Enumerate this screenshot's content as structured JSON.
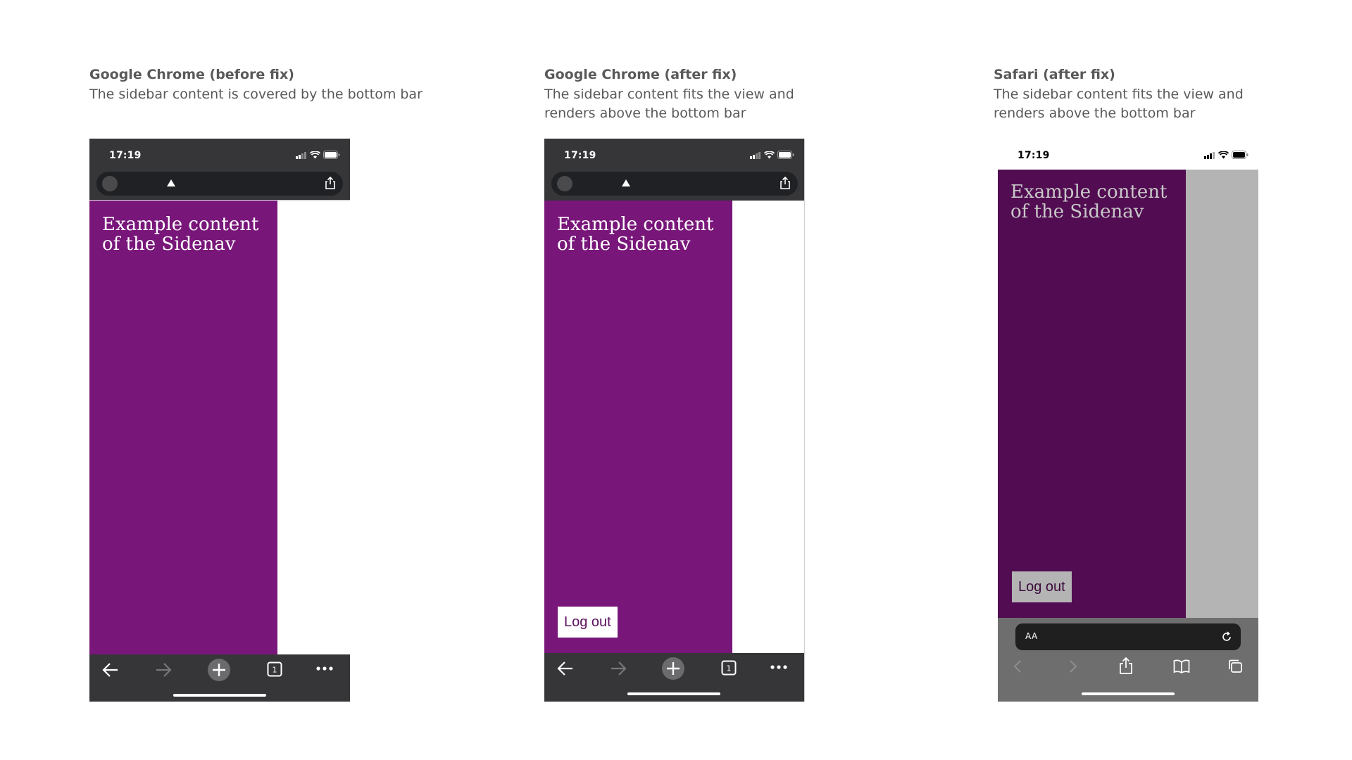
{
  "panels": [
    {
      "title": "Google Chrome (before fix)",
      "description": "The sidebar content is covered by the bottom bar",
      "status_time": "17:19",
      "sidenav_text": "Example content of the Sidenav",
      "logout_label": "",
      "tab_count": "1"
    },
    {
      "title": "Google Chrome (after fix)",
      "description": "The sidebar content fits the view and renders above the bottom bar",
      "status_time": "17:19",
      "sidenav_text": "Example content of the Sidenav",
      "logout_label": "Log out",
      "tab_count": "1"
    },
    {
      "title": "Safari (after fix)",
      "description": "The sidebar content fits the view and renders above the bottom bar",
      "status_time": "17:19",
      "sidenav_text": "Example content of the Sidenav",
      "logout_label": "Log out",
      "address_text_size_label": "AA"
    }
  ],
  "colors": {
    "chrome_bar": "#363638",
    "sidenav_purple": "#78167a",
    "safari_sidenav": "#520d52",
    "safari_overlay": "#b4b4b4",
    "safari_bar": "#6e6e6e",
    "caption_text": "#595959"
  },
  "icons": {
    "incognito": "incognito-icon",
    "share": "share-icon",
    "back": "back-arrow-icon",
    "forward": "forward-arrow-icon",
    "new_tab": "plus-icon",
    "tabs": "tab-switcher-icon",
    "menu": "more-dots-icon",
    "reload": "reload-icon",
    "bookmarks": "book-icon",
    "safari_tabs": "tabs-overview-icon",
    "signal": "signal-icon",
    "wifi": "wifi-icon",
    "battery": "battery-icon"
  }
}
